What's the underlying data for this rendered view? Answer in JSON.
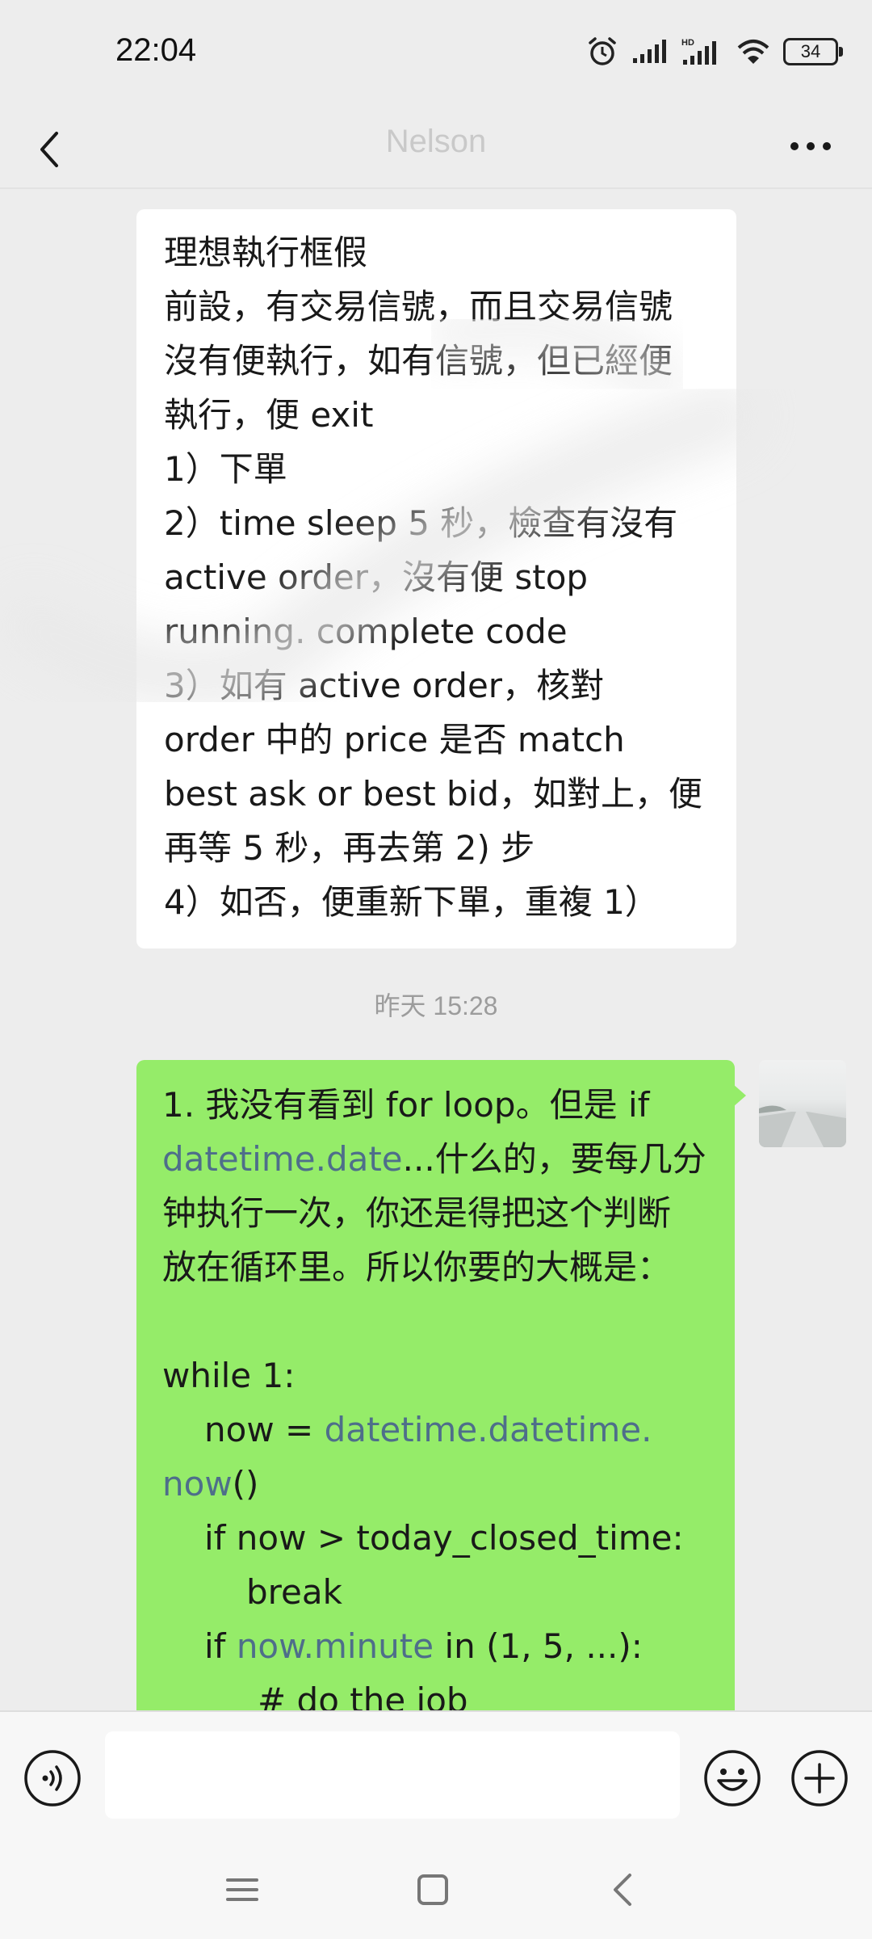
{
  "status_bar": {
    "time": "22:04",
    "battery": "34"
  },
  "nav": {
    "title": "Nelson"
  },
  "messages": {
    "incoming_lines": [
      "理想執行框假",
      "前設，有交易信號，而且交易信號",
      "沒有便執行，如有信號，但已經便",
      "執行，便 exit",
      "1）下單",
      "2）time sleep 5 秒，檢查有沒有",
      "active order，沒有便 stop",
      "running. complete code",
      "3）如有 active order，核對",
      "order 中的 price 是否 match",
      "best ask or best bid，如對上，便",
      "再等 5 秒，再去第 2) 步",
      "4）如否，便重新下單，重複 1）"
    ],
    "timestamp": "昨天 15:28",
    "outgoing": {
      "l1": "1. 我没有看到 for loop。但是 if",
      "l2_link": "datetime.date",
      "l2_text": "...什么的，要每几分",
      "l3": "钟执行一次，你还是得把这个判断",
      "l4": "放在循环里。所以你要的大概是：",
      "l5": "while 1:",
      "l6_pre": "now = ",
      "l6_link": "datetime.datetime.",
      "l7_link": "now",
      "l7_text": "()",
      "l8": "if now > today_closed_time:",
      "l9": "break",
      "l10_pre": "if ",
      "l10_link": "now.minute",
      "l10_text": " in (1, 5, ...):",
      "l11": "# do the job"
    }
  },
  "colors": {
    "outgoing_bubble": "#95ec69",
    "incoming_bubble": "#ffffff",
    "link": "#4e6e8a",
    "background": "#ededed"
  },
  "icons": [
    "back-arrow-icon",
    "more-dots-icon",
    "voice-icon",
    "emoji-icon",
    "plus-icon",
    "menu-icon",
    "home-square-icon",
    "back-triangle-icon"
  ]
}
